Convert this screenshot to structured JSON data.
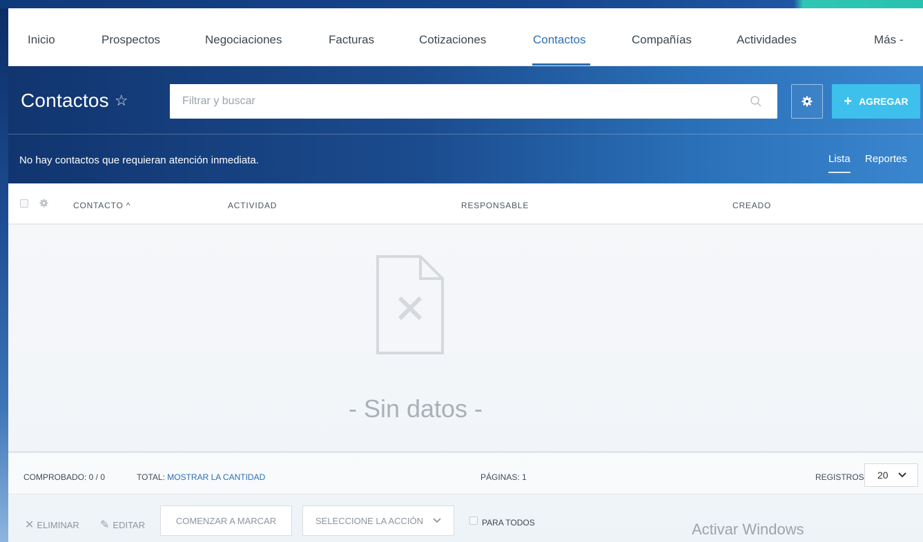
{
  "nav": {
    "items": [
      "Inicio",
      "Prospectos",
      "Negociaciones",
      "Facturas",
      "Cotizaciones",
      "Contactos",
      "Compañías",
      "Actividades",
      "Más -"
    ],
    "active": "Contactos"
  },
  "header": {
    "title": "Contactos",
    "star": "☆",
    "search_placeholder": "Filtrar y buscar",
    "add_label": "AGREGAR",
    "notice": "No hay contactos que requieran atención inmediata.",
    "views": [
      "Lista",
      "Reportes"
    ]
  },
  "table": {
    "columns": [
      "CONTACTO ^",
      "ACTIVIDAD",
      "RESPONSABLE",
      "CREADO"
    ],
    "empty_text": "- Sin datos -"
  },
  "footer": {
    "checked": "COMPROBADO: 0 / 0",
    "total_label": "TOTAL:",
    "total_link": "MOSTRAR LA CANTIDAD",
    "pages": "PÁGINAS: 1",
    "records_label": "REGISTROS:",
    "records_value": "20"
  },
  "actions": {
    "delete": "ELIMINAR",
    "edit": "EDITAR",
    "start_mark": "COMENZAR A MARCAR",
    "select_action": "SELECCIONE LA ACCIÓN",
    "for_all": "PARA TODOS"
  },
  "watermark": "Activar Windows",
  "colors": {
    "accent": "#2c6fb3",
    "add_button": "#3ec0ec",
    "header_dark": "#11356f"
  }
}
